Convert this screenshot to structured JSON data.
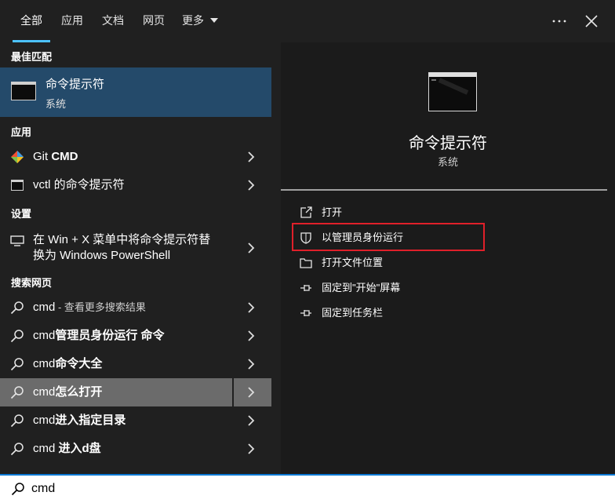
{
  "tabs": [
    {
      "label": "全部",
      "active": true
    },
    {
      "label": "应用"
    },
    {
      "label": "文档"
    },
    {
      "label": "网页"
    },
    {
      "label": "更多"
    }
  ],
  "sections": {
    "best_match": "最佳匹配",
    "apps": "应用",
    "settings": "设置",
    "web": "搜索网页"
  },
  "best_match": {
    "title": "命令提示符",
    "subtitle": "系统",
    "icon": "cmd-window-icon"
  },
  "apps": [
    {
      "prefix": "Git ",
      "bold": "CMD",
      "icon": "git-icon"
    },
    {
      "prefix": "vctl 的命令提示符",
      "bold": "",
      "icon": "cmd-small-icon"
    }
  ],
  "settings_item": {
    "line1": "在 Win + X 菜单中将命令提示符替",
    "line2": "换为 Windows PowerShell",
    "icon": "display-icon"
  },
  "web_results": [
    {
      "prefix": "cmd",
      "bold": "",
      "suffix": " - 查看更多搜索结果"
    },
    {
      "prefix": "cmd",
      "bold": "管理员身份运行 命令",
      "suffix": ""
    },
    {
      "prefix": "cmd",
      "bold": "命令大全",
      "suffix": ""
    },
    {
      "prefix": "cmd",
      "bold": "怎么打开",
      "suffix": ""
    },
    {
      "prefix": "cmd",
      "bold": "进入指定目录",
      "suffix": ""
    },
    {
      "prefix": "cmd ",
      "bold": "进入d盘",
      "suffix": ""
    }
  ],
  "preview": {
    "title": "命令提示符",
    "subtitle": "系统",
    "actions": [
      {
        "label": "打开",
        "icon": "open-icon"
      },
      {
        "label": "以管理员身份运行",
        "icon": "shield-icon"
      },
      {
        "label": "打开文件位置",
        "icon": "folder-icon"
      },
      {
        "label": "固定到\"开始\"屏幕",
        "icon": "pin-icon"
      },
      {
        "label": "固定到任务栏",
        "icon": "pin-icon"
      }
    ]
  },
  "search": {
    "value": "cmd"
  },
  "colors": {
    "accent": "#4cc2ff",
    "selection": "#244a6a",
    "highlight_box": "#e0202a",
    "hover_row": "#6b6b6b"
  }
}
